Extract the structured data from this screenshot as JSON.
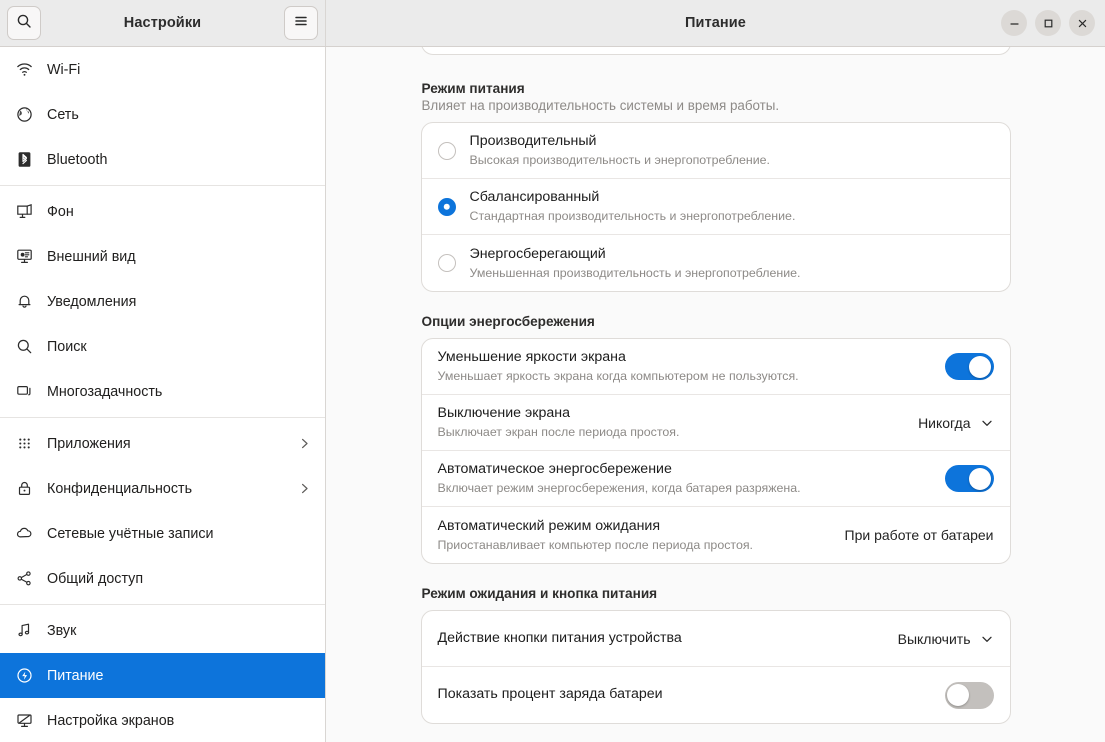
{
  "window": {
    "sidebar_title": "Настройки",
    "panel_title": "Питание",
    "search_icon": "search-icon",
    "menu_icon": "hamburger-menu-icon",
    "minimize_label": "–",
    "maximize_label": "□",
    "close_label": "×",
    "accent_color": "#0d74db"
  },
  "sidebar": {
    "items": [
      {
        "label": "Wi-Fi",
        "icon": "wifi-icon",
        "selected": false,
        "chevron": false
      },
      {
        "label": "Сеть",
        "icon": "network-globe-icon",
        "selected": false,
        "chevron": false
      },
      {
        "label": "Bluetooth",
        "icon": "bluetooth-icon",
        "selected": false,
        "chevron": false
      },
      {
        "label": "Фон",
        "icon": "background-wallpaper-icon",
        "selected": false,
        "chevron": false
      },
      {
        "label": "Внешний вид",
        "icon": "appearance-icon",
        "selected": false,
        "chevron": false
      },
      {
        "label": "Уведомления",
        "icon": "bell-notifications-icon",
        "selected": false,
        "chevron": false
      },
      {
        "label": "Поиск",
        "icon": "search-icon",
        "selected": false,
        "chevron": false
      },
      {
        "label": "Многозадачность",
        "icon": "multitasking-windows-icon",
        "selected": false,
        "chevron": false
      },
      {
        "label": "Приложения",
        "icon": "apps-grid-icon",
        "selected": false,
        "chevron": true
      },
      {
        "label": "Конфиденциальность",
        "icon": "lock-privacy-icon",
        "selected": false,
        "chevron": true
      },
      {
        "label": "Сетевые учётные записи",
        "icon": "cloud-accounts-icon",
        "selected": false,
        "chevron": false
      },
      {
        "label": "Общий доступ",
        "icon": "share-nodes-icon",
        "selected": false,
        "chevron": false
      },
      {
        "label": "Звук",
        "icon": "music-note-sound-icon",
        "selected": false,
        "chevron": false
      },
      {
        "label": "Питание",
        "icon": "power-plug-icon",
        "selected": true,
        "chevron": false
      },
      {
        "label": "Настройка экранов",
        "icon": "displays-monitor-icon",
        "selected": false,
        "chevron": false
      }
    ]
  },
  "main": {
    "power_mode": {
      "title": "Режим питания",
      "description": "Влияет на производительность системы и время работы.",
      "options": [
        {
          "label": "Производительный",
          "sub": "Высокая производительность и энергопотребление.",
          "selected": false
        },
        {
          "label": "Сбалансированный",
          "sub": "Стандартная производительность и энергопотребление.",
          "selected": true
        },
        {
          "label": "Энергосберегающий",
          "sub": "Уменьшенная производительность и энергопотребление.",
          "selected": false
        }
      ]
    },
    "power_saving": {
      "title": "Опции энергосбережения",
      "rows": [
        {
          "label": "Уменьшение яркости экрана",
          "sub": "Уменьшает яркость экрана когда компьютером не пользуются.",
          "control": "toggle",
          "value": "on"
        },
        {
          "label": "Выключение экрана",
          "sub": "Выключает экран после периода простоя.",
          "control": "dropdown",
          "value": "Никогда"
        },
        {
          "label": "Автоматическое энергосбережение",
          "sub": "Включает режим энергосбережения, когда батарея разряжена.",
          "control": "toggle",
          "value": "on"
        },
        {
          "label": "Автоматический режим ожидания",
          "sub": "Приостанавливает компьютер после периода простоя.",
          "control": "text",
          "value": "При работе от батареи"
        }
      ]
    },
    "suspend_power_button": {
      "title": "Режим ожидания и кнопка питания",
      "rows": [
        {
          "label": "Действие кнопки питания устройства",
          "sub": "",
          "control": "dropdown",
          "value": "Выключить"
        },
        {
          "label": "Показать процент заряда батареи",
          "sub": "",
          "control": "toggle",
          "value": "off"
        }
      ]
    }
  }
}
